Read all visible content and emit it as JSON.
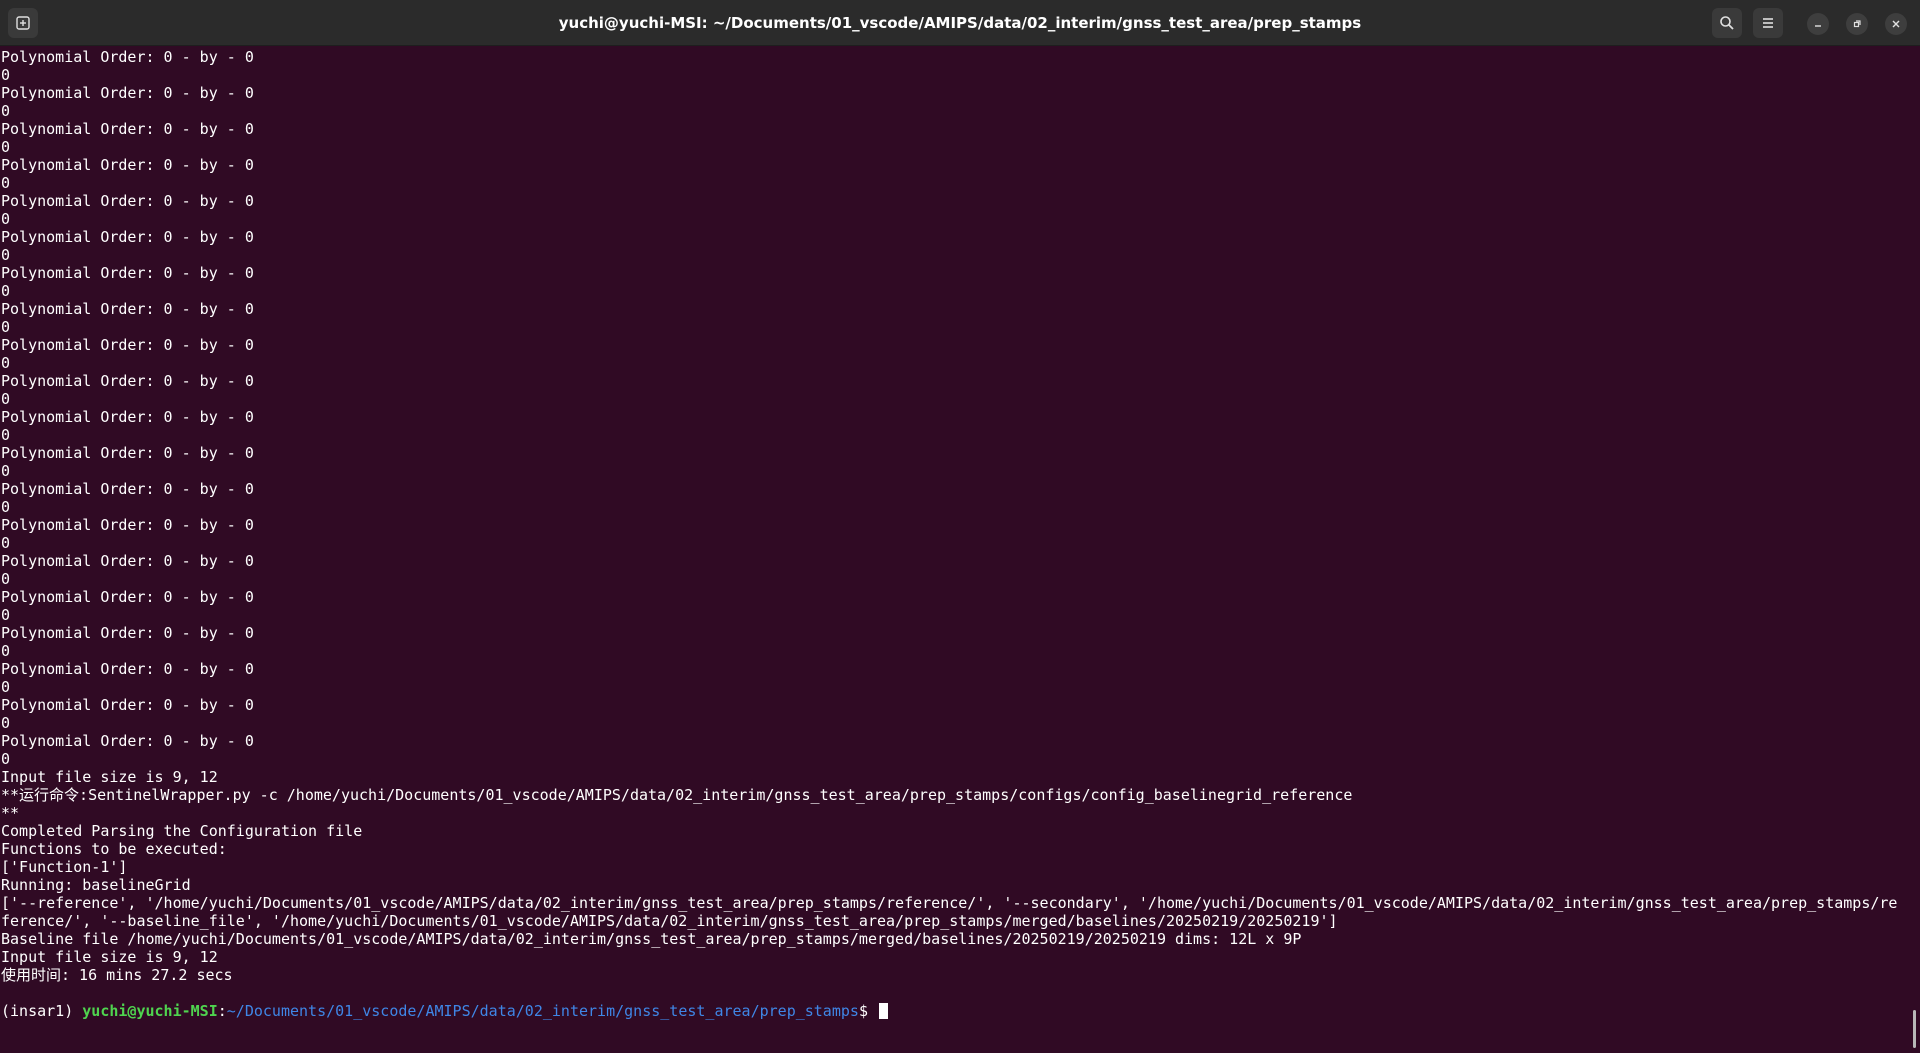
{
  "window": {
    "title": "yuchi@yuchi-MSI: ~/Documents/01_vscode/AMIPS/data/02_interim/gnss_test_area/prep_stamps",
    "icons": [
      "new-tab-icon",
      "search-icon",
      "hamburger-menu-icon",
      "minimize-icon",
      "restore-icon",
      "close-icon"
    ]
  },
  "terminal": {
    "lines": [
      "Polynomial Order: 0 - by - 0",
      "0",
      "Polynomial Order: 0 - by - 0",
      "0",
      "Polynomial Order: 0 - by - 0",
      "0",
      "Polynomial Order: 0 - by - 0",
      "0",
      "Polynomial Order: 0 - by - 0",
      "0",
      "Polynomial Order: 0 - by - 0",
      "0",
      "Polynomial Order: 0 - by - 0",
      "0",
      "Polynomial Order: 0 - by - 0",
      "0",
      "Polynomial Order: 0 - by - 0",
      "0",
      "Polynomial Order: 0 - by - 0",
      "0",
      "Polynomial Order: 0 - by - 0",
      "0",
      "Polynomial Order: 0 - by - 0",
      "0",
      "Polynomial Order: 0 - by - 0",
      "0",
      "Polynomial Order: 0 - by - 0",
      "0",
      "Polynomial Order: 0 - by - 0",
      "0",
      "Polynomial Order: 0 - by - 0",
      "0",
      "Polynomial Order: 0 - by - 0",
      "0",
      "Polynomial Order: 0 - by - 0",
      "0",
      "Polynomial Order: 0 - by - 0",
      "0",
      "Polynomial Order: 0 - by - 0",
      "0",
      "Input file size is 9, 12",
      "**运行命令:SentinelWrapper.py -c /home/yuchi/Documents/01_vscode/AMIPS/data/02_interim/gnss_test_area/prep_stamps/configs/config_baselinegrid_reference",
      "**",
      "Completed Parsing the Configuration file",
      "Functions to be executed:",
      "['Function-1']",
      "Running: baselineGrid",
      "['--reference', '/home/yuchi/Documents/01_vscode/AMIPS/data/02_interim/gnss_test_area/prep_stamps/reference/', '--secondary', '/home/yuchi/Documents/01_vscode/AMIPS/data/02_interim/gnss_test_area/prep_stamps/reference/', '--baseline_file', '/home/yuchi/Documents/01_vscode/AMIPS/data/02_interim/gnss_test_area/prep_stamps/merged/baselines/20250219/20250219']",
      "Baseline file /home/yuchi/Documents/01_vscode/AMIPS/data/02_interim/gnss_test_area/prep_stamps/merged/baselines/20250219/20250219 dims: 12L x 9P",
      "Input file size is 9, 12",
      "使用时间: 16 mins 27.2 secs",
      ""
    ],
    "prompt": {
      "env": "(insar1) ",
      "user_host": "yuchi@yuchi-MSI",
      "separator": ":",
      "path": "~/Documents/01_vscode/AMIPS/data/02_interim/gnss_test_area/prep_stamps",
      "dollar": "$ "
    }
  }
}
